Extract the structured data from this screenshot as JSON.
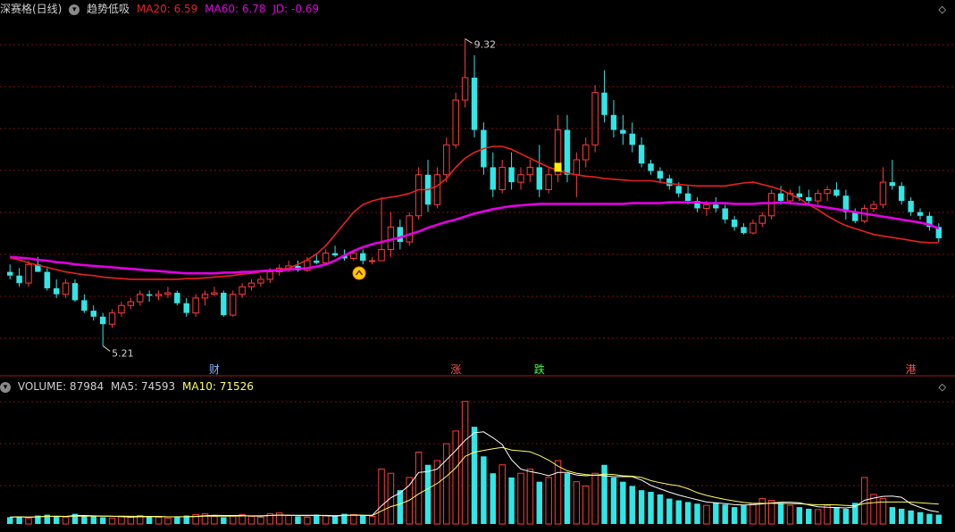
{
  "header": {
    "stock": "深赛格(日线)",
    "indicator": "趋势低吸",
    "ma20_label": "MA20: 6.59",
    "ma60_label": "MA60: 6.78",
    "jd_label": "JD: -0.69"
  },
  "volume_header": {
    "volume_label": "VOLUME: 87984",
    "ma5_label": "MA5: 74593",
    "ma10_label": "MA10: 71526"
  },
  "annotations": {
    "high": "9.32",
    "low": "5.21",
    "markers": [
      "财",
      "涨",
      "跌",
      "港"
    ]
  },
  "colors": {
    "up": "#ff3c3c",
    "down": "#30e6e6",
    "ma20": "#e8231e",
    "ma60": "#e400e4",
    "ma5_vol": "#ffffff",
    "ma10_vol": "#ffff60",
    "grid": "#7a1010",
    "signal": "#ffcc00"
  },
  "icons": {
    "dropdown": "chevron-down-icon",
    "corner": "diamond-icon",
    "signal": "up-arrow-icon"
  },
  "chart_data": [
    {
      "type": "candlestick",
      "series": [
        {
          "name": "MA20",
          "values": [
            6.39,
            6.36,
            6.32,
            6.29,
            6.26,
            6.23,
            6.2,
            6.18,
            6.16,
            6.15,
            6.13,
            6.12,
            6.11,
            6.1,
            6.1,
            6.1,
            6.1,
            6.1,
            6.1,
            6.11,
            6.11,
            6.12,
            6.13,
            6.14,
            6.15,
            6.17,
            6.18,
            6.2,
            6.21,
            6.23,
            6.25,
            6.3,
            6.36,
            6.44,
            6.55,
            6.7,
            6.85,
            7.0,
            7.1,
            7.15,
            7.18,
            7.2,
            7.22,
            7.25,
            7.3,
            7.3,
            7.35,
            7.45,
            7.6,
            7.72,
            7.8,
            7.85,
            7.88,
            7.88,
            7.84,
            7.78,
            7.72,
            7.66,
            7.6,
            7.56,
            7.52,
            7.5,
            7.48,
            7.47,
            7.45,
            7.44,
            7.43,
            7.42,
            7.42,
            7.42,
            7.4,
            7.38,
            7.37,
            7.36,
            7.35,
            7.35,
            7.35,
            7.35,
            7.37,
            7.39,
            7.4,
            7.37,
            7.34,
            7.3,
            7.24,
            7.18,
            7.1,
            7.03,
            6.95,
            6.88,
            6.82,
            6.78,
            6.74,
            6.7,
            6.68,
            6.66,
            6.64,
            6.62,
            6.6,
            6.59,
            6.59
          ]
        },
        {
          "name": "MA60",
          "values": [
            6.4,
            6.39,
            6.38,
            6.36,
            6.35,
            6.33,
            6.32,
            6.3,
            6.29,
            6.28,
            6.27,
            6.26,
            6.25,
            6.24,
            6.23,
            6.22,
            6.21,
            6.2,
            6.19,
            6.18,
            6.18,
            6.18,
            6.18,
            6.19,
            6.19,
            6.2,
            6.2,
            6.21,
            6.22,
            6.22,
            6.23,
            6.24,
            6.25,
            6.27,
            6.3,
            6.35,
            6.42,
            6.48,
            6.53,
            6.57,
            6.6,
            6.63,
            6.66,
            6.7,
            6.74,
            6.79,
            6.83,
            6.87,
            6.9,
            6.94,
            6.98,
            7.01,
            7.04,
            7.06,
            7.08,
            7.09,
            7.1,
            7.11,
            7.11,
            7.11,
            7.11,
            7.11,
            7.11,
            7.11,
            7.11,
            7.11,
            7.11,
            7.12,
            7.12,
            7.12,
            7.12,
            7.13,
            7.13,
            7.13,
            7.13,
            7.12,
            7.12,
            7.12,
            7.11,
            7.11,
            7.11,
            7.12,
            7.12,
            7.13,
            7.12,
            7.11,
            7.1,
            7.08,
            7.06,
            7.04,
            7.02,
            7.0,
            6.98,
            6.96,
            6.94,
            6.92,
            6.9,
            6.88,
            6.86,
            6.83,
            6.78
          ]
        }
      ],
      "ohlc": [
        [
          6.2,
          6.3,
          6.1,
          6.15
        ],
        [
          6.15,
          6.25,
          6.0,
          6.05
        ],
        [
          6.05,
          6.35,
          6.0,
          6.3
        ],
        [
          6.3,
          6.4,
          6.2,
          6.2
        ],
        [
          6.2,
          6.25,
          5.95,
          5.98
        ],
        [
          5.98,
          6.1,
          5.85,
          5.9
        ],
        [
          5.9,
          6.1,
          5.85,
          6.05
        ],
        [
          6.05,
          6.1,
          5.8,
          5.82
        ],
        [
          5.82,
          5.9,
          5.65,
          5.68
        ],
        [
          5.68,
          5.75,
          5.55,
          5.6
        ],
        [
          5.6,
          5.65,
          5.21,
          5.5
        ],
        [
          5.5,
          5.7,
          5.45,
          5.65
        ],
        [
          5.65,
          5.8,
          5.6,
          5.75
        ],
        [
          5.75,
          5.85,
          5.7,
          5.8
        ],
        [
          5.8,
          5.95,
          5.75,
          5.9
        ],
        [
          5.9,
          5.95,
          5.8,
          5.88
        ],
        [
          5.88,
          5.95,
          5.82,
          5.9
        ],
        [
          5.9,
          6.0,
          5.85,
          5.92
        ],
        [
          5.92,
          5.95,
          5.75,
          5.78
        ],
        [
          5.78,
          5.85,
          5.6,
          5.65
        ],
        [
          5.65,
          5.9,
          5.6,
          5.85
        ],
        [
          5.85,
          5.95,
          5.75,
          5.9
        ],
        [
          5.9,
          6.0,
          5.88,
          5.92
        ],
        [
          5.92,
          5.95,
          5.6,
          5.62
        ],
        [
          5.62,
          5.95,
          5.6,
          5.9
        ],
        [
          5.9,
          6.05,
          5.85,
          6.0
        ],
        [
          6.0,
          6.1,
          5.95,
          6.05
        ],
        [
          6.05,
          6.15,
          6.0,
          6.1
        ],
        [
          6.1,
          6.25,
          6.05,
          6.2
        ],
        [
          6.2,
          6.3,
          6.15,
          6.25
        ],
        [
          6.25,
          6.35,
          6.2,
          6.28
        ],
        [
          6.28,
          6.35,
          6.2,
          6.22
        ],
        [
          6.22,
          6.4,
          6.2,
          6.35
        ],
        [
          6.35,
          6.45,
          6.3,
          6.32
        ],
        [
          6.32,
          6.5,
          6.3,
          6.45
        ],
        [
          6.45,
          6.55,
          6.4,
          6.42
        ],
        [
          6.42,
          6.5,
          6.35,
          6.38
        ],
        [
          6.38,
          6.48,
          6.35,
          6.45
        ],
        [
          6.45,
          6.5,
          6.3,
          6.35
        ],
        [
          6.35,
          6.4,
          6.3,
          6.35
        ],
        [
          6.35,
          7.2,
          6.35,
          6.5
        ],
        [
          6.5,
          7.0,
          6.4,
          6.8
        ],
        [
          6.8,
          6.9,
          6.5,
          6.6
        ],
        [
          6.6,
          7.0,
          6.55,
          6.95
        ],
        [
          6.95,
          7.6,
          6.9,
          7.5
        ],
        [
          7.5,
          7.7,
          7.0,
          7.1
        ],
        [
          7.1,
          7.6,
          7.05,
          7.5
        ],
        [
          7.5,
          8.0,
          7.4,
          7.9
        ],
        [
          7.9,
          8.6,
          7.85,
          8.5
        ],
        [
          8.5,
          9.32,
          8.4,
          8.8
        ],
        [
          8.8,
          9.1,
          8.0,
          8.1
        ],
        [
          8.1,
          8.2,
          7.5,
          7.6
        ],
        [
          7.6,
          7.8,
          7.2,
          7.3
        ],
        [
          7.3,
          7.7,
          7.25,
          7.6
        ],
        [
          7.6,
          7.8,
          7.3,
          7.4
        ],
        [
          7.4,
          7.6,
          7.3,
          7.5
        ],
        [
          7.5,
          7.7,
          7.4,
          7.6
        ],
        [
          7.6,
          7.9,
          7.2,
          7.3
        ],
        [
          7.3,
          7.6,
          7.25,
          7.5
        ],
        [
          7.5,
          8.3,
          7.4,
          8.1
        ],
        [
          8.1,
          8.3,
          7.4,
          7.5
        ],
        [
          7.5,
          7.8,
          7.2,
          7.7
        ],
        [
          7.7,
          8.0,
          7.6,
          7.9
        ],
        [
          7.9,
          8.7,
          7.8,
          8.6
        ],
        [
          8.6,
          8.9,
          8.2,
          8.3
        ],
        [
          8.3,
          8.5,
          8.0,
          8.1
        ],
        [
          8.1,
          8.3,
          7.9,
          8.05
        ],
        [
          8.05,
          8.2,
          7.8,
          7.9
        ],
        [
          7.9,
          8.0,
          7.6,
          7.65
        ],
        [
          7.65,
          7.7,
          7.5,
          7.55
        ],
        [
          7.55,
          7.6,
          7.4,
          7.45
        ],
        [
          7.45,
          7.5,
          7.3,
          7.35
        ],
        [
          7.35,
          7.4,
          7.2,
          7.25
        ],
        [
          7.25,
          7.35,
          7.1,
          7.15
        ],
        [
          7.15,
          7.2,
          7.0,
          7.05
        ],
        [
          7.05,
          7.15,
          6.95,
          7.1
        ],
        [
          7.1,
          7.2,
          7.0,
          7.05
        ],
        [
          7.05,
          7.1,
          6.85,
          6.9
        ],
        [
          6.9,
          6.95,
          6.75,
          6.8
        ],
        [
          6.8,
          6.85,
          6.7,
          6.72
        ],
        [
          6.72,
          6.9,
          6.7,
          6.85
        ],
        [
          6.85,
          7.0,
          6.8,
          6.95
        ],
        [
          6.95,
          7.3,
          6.9,
          7.25
        ],
        [
          7.25,
          7.35,
          7.1,
          7.15
        ],
        [
          7.15,
          7.3,
          7.1,
          7.25
        ],
        [
          7.25,
          7.35,
          7.15,
          7.2
        ],
        [
          7.2,
          7.3,
          7.1,
          7.15
        ],
        [
          7.15,
          7.3,
          7.1,
          7.25
        ],
        [
          7.25,
          7.35,
          7.15,
          7.3
        ],
        [
          7.3,
          7.4,
          7.2,
          7.22
        ],
        [
          7.22,
          7.3,
          6.9,
          7.0
        ],
        [
          7.0,
          7.05,
          6.85,
          6.88
        ],
        [
          6.88,
          7.1,
          6.85,
          7.05
        ],
        [
          7.05,
          7.15,
          7.0,
          7.1
        ],
        [
          7.1,
          7.6,
          7.05,
          7.4
        ],
        [
          7.4,
          7.7,
          7.3,
          7.35
        ],
        [
          7.35,
          7.4,
          7.1,
          7.15
        ],
        [
          7.15,
          7.2,
          6.95,
          7.0
        ],
        [
          7.0,
          7.05,
          6.9,
          6.95
        ],
        [
          6.95,
          7.0,
          6.75,
          6.8
        ],
        [
          6.8,
          6.85,
          6.6,
          6.65
        ]
      ],
      "ylim": [
        5.0,
        9.6
      ]
    },
    {
      "type": "bar",
      "series": [
        {
          "name": "VOLUME",
          "values": [
            8,
            9,
            7,
            10,
            11,
            9,
            8,
            12,
            10,
            9,
            8,
            7,
            9,
            8,
            10,
            9,
            8,
            7,
            9,
            10,
            11,
            12,
            9,
            8,
            10,
            11,
            9,
            8,
            12,
            13,
            10,
            9,
            8,
            11,
            10,
            9,
            12,
            11,
            10,
            9,
            65,
            60,
            40,
            55,
            85,
            70,
            75,
            95,
            110,
            145,
            115,
            80,
            60,
            70,
            55,
            60,
            65,
            50,
            55,
            75,
            60,
            50,
            45,
            60,
            70,
            55,
            50,
            45,
            40,
            38,
            35,
            30,
            28,
            26,
            24,
            22,
            25,
            23,
            20,
            22,
            24,
            30,
            28,
            25,
            22,
            20,
            18,
            17,
            22,
            20,
            18,
            25,
            55,
            35,
            30,
            20,
            18,
            16,
            14,
            12,
            11
          ]
        },
        {
          "name": "MA5",
          "values": []
        },
        {
          "name": "MA10",
          "values": []
        }
      ]
    }
  ]
}
